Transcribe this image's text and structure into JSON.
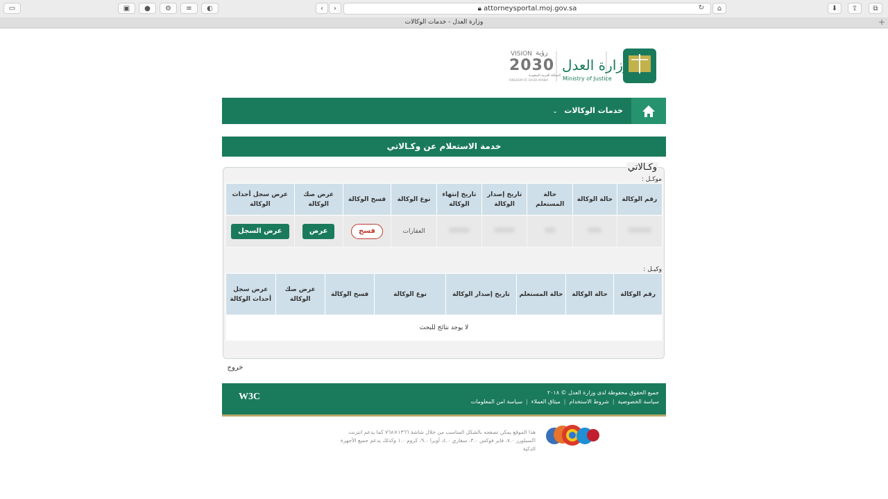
{
  "browser": {
    "url": "attorneysportal.moj.gov.sa",
    "tab_title": "وزارة العدل - خدمات الوكالات"
  },
  "logo": {
    "ministry_ar": "وزارة العدل",
    "ministry_en": "Ministry of Justice",
    "vision_label": "VISION",
    "vision_ar": "رؤية",
    "vision_year": "2030",
    "vision_sub_ar": "المملكة العربية السعودية",
    "vision_sub_en": "KINGDOM OF SAUDI ARABIA"
  },
  "nav": {
    "services_label": "خدمات الوكالات"
  },
  "section_title": "خدمة الاستعلام عن وكـالاتي",
  "panel": {
    "title": "وكـالاتي",
    "principal_label": "موكـل :",
    "agent_label": "وكيـل :"
  },
  "principal_table": {
    "headers": [
      "رقم الوكالة",
      "حالة الوكالة",
      "حالة المستعلم",
      "تاريخ إصدار الوكالة",
      "تاريخ إنتهاء الوكالة",
      "نوع الوكالة",
      "فسخ الوكالة",
      "عرض صك الوكالة",
      "عرض سجل أحداث الوكالة"
    ],
    "row": {
      "type": "العقارات",
      "cancel_label": "فسخ",
      "view_label": "عرض",
      "log_label": "عرض السجل"
    }
  },
  "agent_table": {
    "headers": [
      "رقم الوكالة",
      "حالة الوكالة",
      "حالة المستعلم",
      "تاريخ إصدار الوكالة",
      "نوع الوكالة",
      "فسخ الوكالة",
      "عرض صك الوكالة",
      "عرض سجل أحداث الوكالة"
    ],
    "empty_text": "لا يوجد نتائج للبحث"
  },
  "exit_label": "خروج",
  "footer": {
    "copyright": "جميع الحقوق محفوظة لدى وزارة العدل © ٢٠١٨",
    "links": [
      "سياسة الخصوصية",
      "شروط الاستخدام",
      "ميثاق العملاء",
      "سياسة امن المعلومات"
    ],
    "w3c": "W3C"
  },
  "notice": "هذا الموقع يمكن تصفحه بالشكل المناسب من خلال شاشة ١٣٦٦×٧٦٨ كما يدعم انترنت اكسبلورر ٧.٠، فاير فوكس ٣.٠، سفاري ٤.٠، أوبرا ٩.٠، كروم ١.٠ وكذلك يدعم جميع الأجهزة الذكية",
  "colors": {
    "brand_green": "#1a7a5c",
    "header_cell": "#cfdfe9",
    "cancel_red": "#c0392b"
  }
}
